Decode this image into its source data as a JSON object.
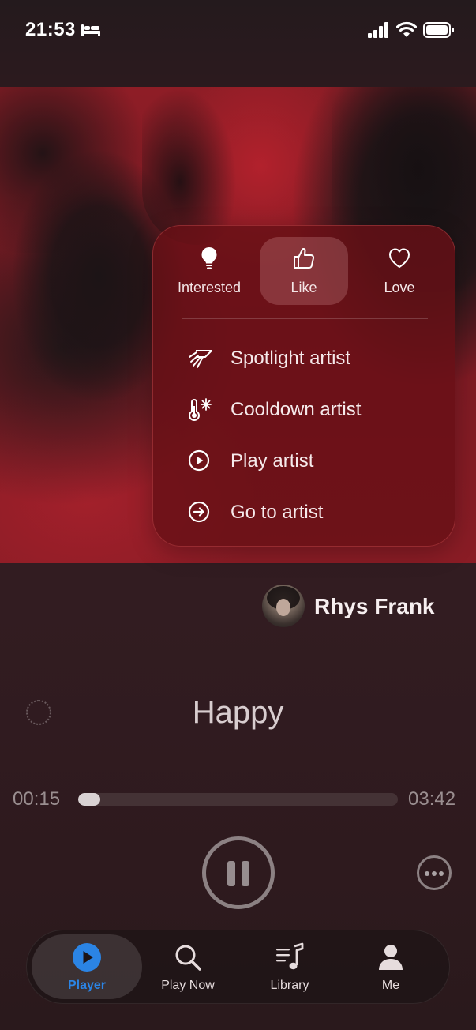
{
  "status_bar": {
    "time": "21:53",
    "icons": [
      "bed-icon",
      "cellular-signal-icon",
      "wifi-icon",
      "battery-icon"
    ]
  },
  "context_menu": {
    "reactions": [
      {
        "label": "Interested",
        "icon": "lightbulb-icon",
        "selected": false
      },
      {
        "label": "Like",
        "icon": "thumbs-up-icon",
        "selected": true
      },
      {
        "label": "Love",
        "icon": "heart-icon",
        "selected": false
      }
    ],
    "items": [
      {
        "label": "Spotlight artist",
        "icon": "spotlight-icon"
      },
      {
        "label": "Cooldown artist",
        "icon": "thermometer-snowflake-icon"
      },
      {
        "label": "Play artist",
        "icon": "play-circle-icon"
      },
      {
        "label": "Go to artist",
        "icon": "arrow-right-circle-icon"
      }
    ]
  },
  "now_playing": {
    "artist": "Rhys Frank",
    "title": "Happy",
    "elapsed": "00:15",
    "duration": "03:42",
    "progress_fraction": 0.068
  },
  "tab_bar": {
    "tabs": [
      {
        "label": "Player",
        "icon": "play-circle-icon",
        "active": true
      },
      {
        "label": "Play Now",
        "icon": "search-icon",
        "active": false
      },
      {
        "label": "Library",
        "icon": "music-list-icon",
        "active": false
      },
      {
        "label": "Me",
        "icon": "person-icon",
        "active": false
      }
    ]
  },
  "colors": {
    "accent": "#2b84e4",
    "menu_background": "#681016",
    "artwork_red": "#8e1d26"
  }
}
